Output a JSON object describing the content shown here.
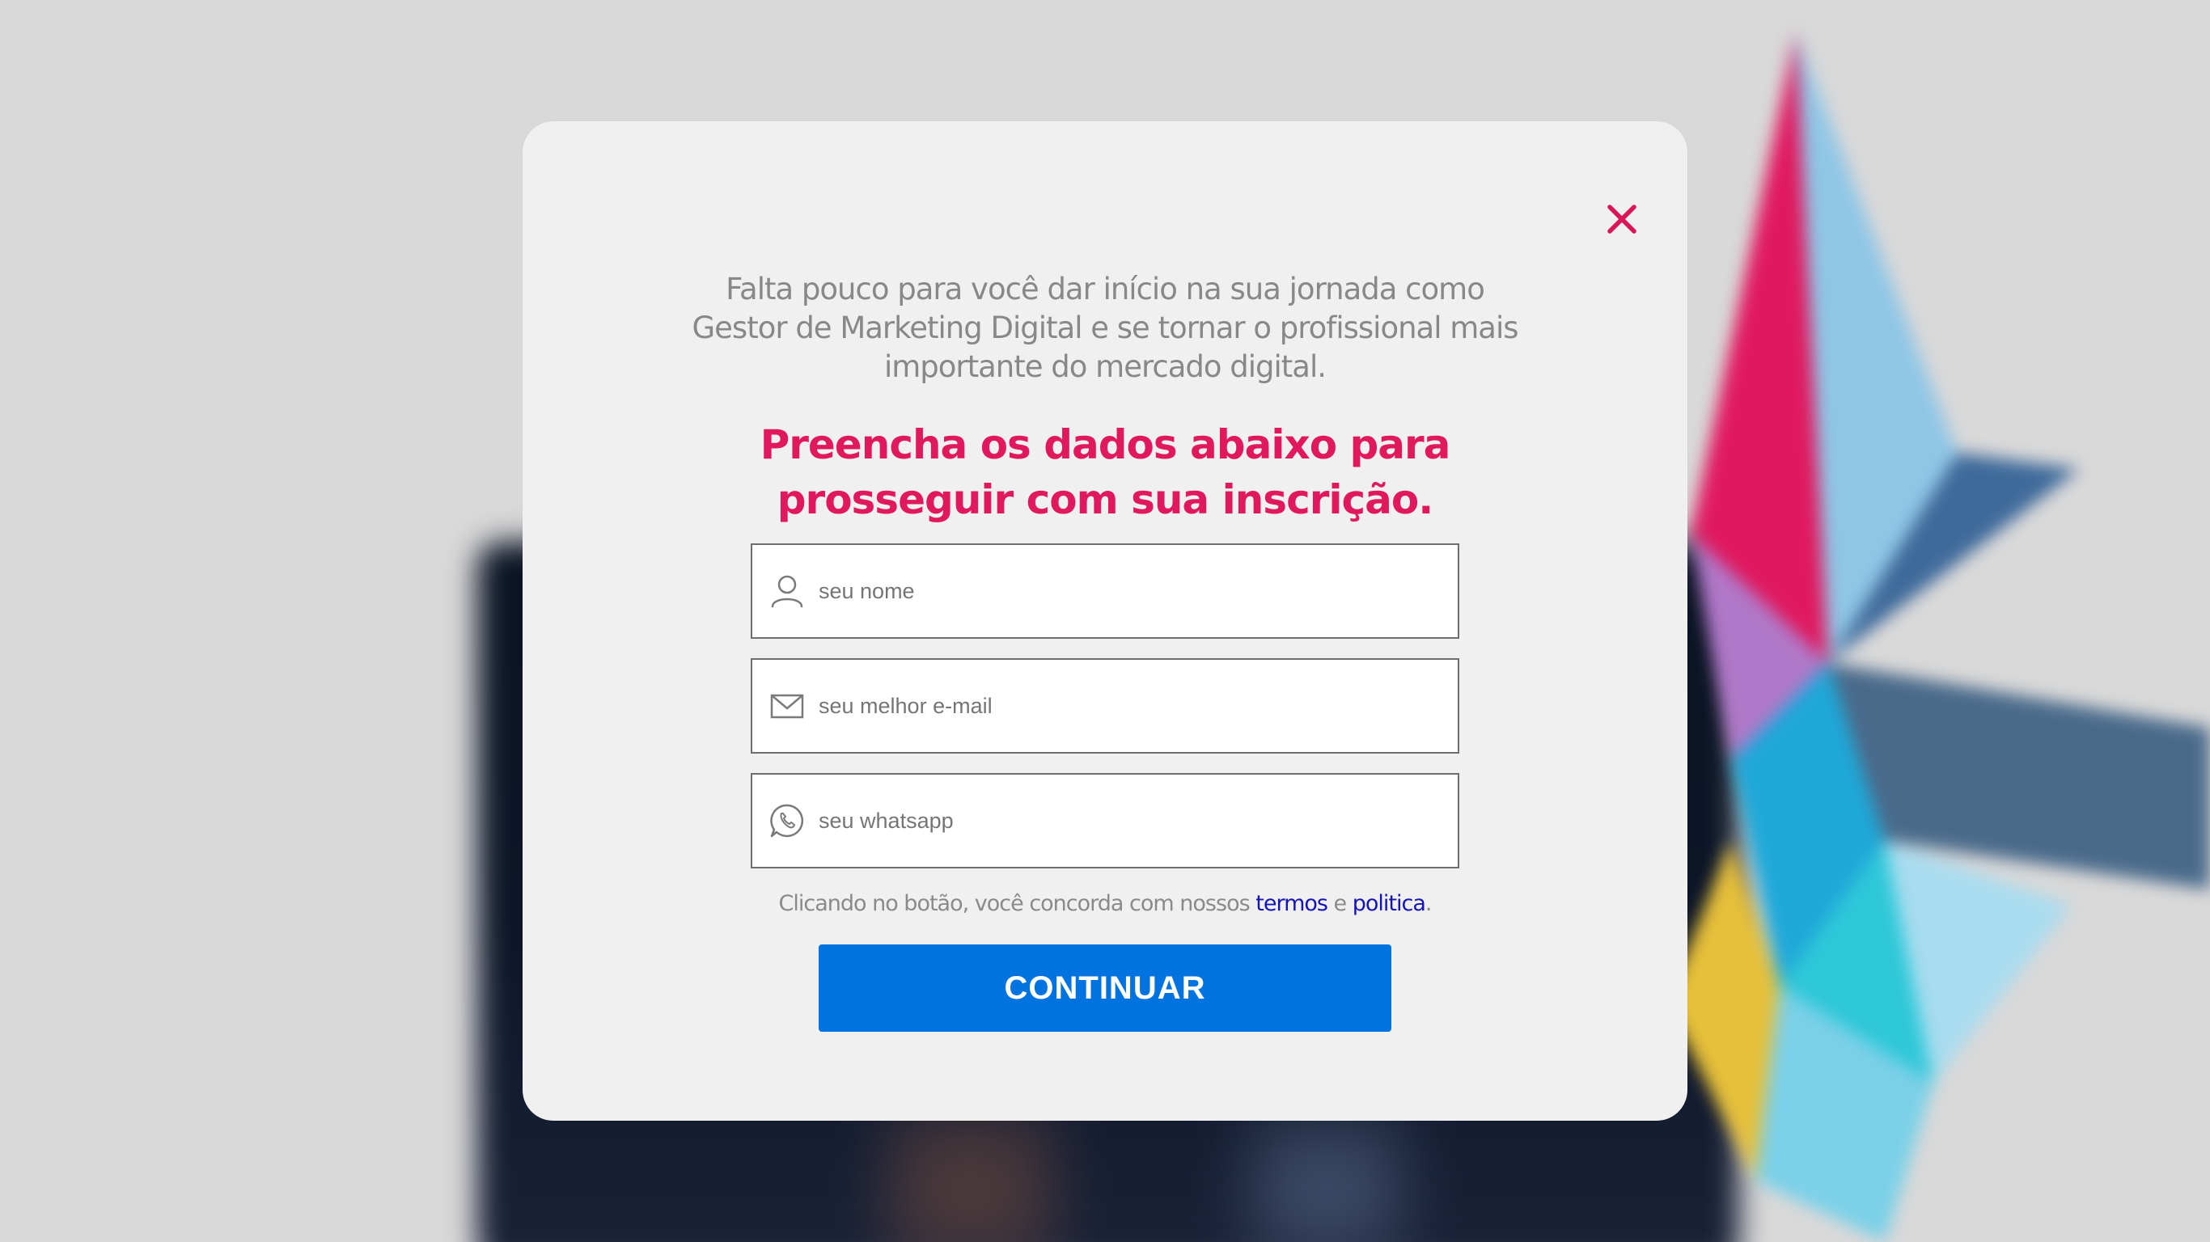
{
  "colors": {
    "accent_pink": "#e0195f",
    "button_blue": "#0073e1",
    "link_blue": "#1414b8",
    "modal_bg": "#f0f0f0",
    "muted_text": "#888888"
  },
  "modal": {
    "close_icon": "close-x-icon",
    "intro_text": "Falta pouco para você dar início na sua jornada como Gestor de Marketing Digital e se tornar o profissional mais importante do mercado digital.",
    "headline": "Preencha os dados abaixo para prosseguir com sua inscrição.",
    "fields": [
      {
        "icon": "user-icon",
        "placeholder": "seu nome",
        "value": ""
      },
      {
        "icon": "envelope-icon",
        "placeholder": "seu melhor e-mail",
        "value": ""
      },
      {
        "icon": "whatsapp-icon",
        "placeholder": "seu whatsapp",
        "value": ""
      }
    ],
    "consent": {
      "prefix": "Clicando no botão, você concorda com nossos ",
      "terms_link": "termos",
      "conjunction": " e ",
      "policy_link": "politica",
      "suffix": "."
    },
    "continue_label": "CONTINUAR"
  }
}
